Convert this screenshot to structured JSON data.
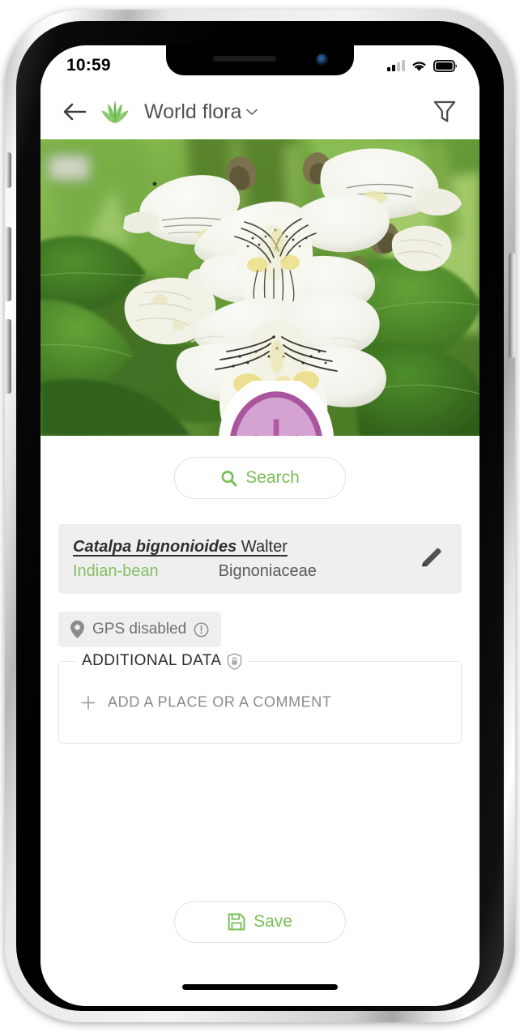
{
  "status_bar": {
    "time": "10:59",
    "signal_icon": "cellular-signal-icon",
    "signal_bars_filled": 2,
    "signal_bars_total": 4,
    "wifi_icon": "wifi-icon",
    "battery_icon": "battery-full-icon"
  },
  "app_bar": {
    "back_icon": "back-arrow-icon",
    "logo_icon": "plant-leaf-logo-icon",
    "title": "World flora",
    "chevron_icon": "chevron-down-icon",
    "filter_icon": "filter-funnel-icon"
  },
  "photo": {
    "alt": "Catalpa bignonioides white flowers close-up",
    "badge_icon": "flower-sticker-icon"
  },
  "search": {
    "icon": "search-icon",
    "label": "Search"
  },
  "species": {
    "scientific_name": "Catalpa bignonioides",
    "author": " Walter",
    "common_name": "Indian-bean",
    "family": "Bignoniaceae",
    "edit_icon": "pencil-edit-icon"
  },
  "gps": {
    "pin_icon": "map-pin-icon",
    "label": "GPS disabled",
    "warning_icon": "exclamation-circle-icon"
  },
  "additional_data": {
    "legend": "ADDITIONAL DATA",
    "privacy_icon": "shield-lock-icon",
    "add_icon": "plus-icon",
    "add_label": "ADD A PLACE OR A COMMENT"
  },
  "save": {
    "icon": "floppy-disk-save-icon",
    "label": "Save"
  },
  "home_indicator": "home-indicator-bar",
  "colors": {
    "accent_green": "#84c065",
    "search_green": "#79bf56",
    "card_gray": "#efefef",
    "text_dark": "#2f2f2f",
    "text_muted": "#707070"
  }
}
